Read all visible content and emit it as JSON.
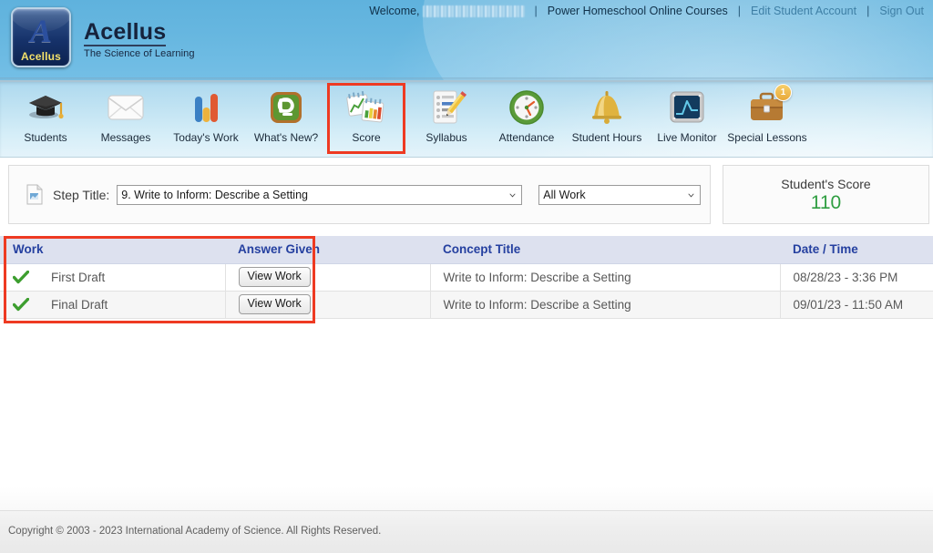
{
  "header": {
    "logo": {
      "badge_letter": "A",
      "badge_word": "Acellus",
      "title": "Acellus",
      "subtitle": "The Science of Learning"
    },
    "welcome_prefix": "Welcome,",
    "welcome_name_redacted": "",
    "links": [
      {
        "label": "Power Homeschool Online Courses",
        "muted": false
      },
      {
        "label": "Edit Student Account",
        "muted": true
      },
      {
        "label": "Sign Out",
        "muted": true
      }
    ],
    "separator": "|",
    "colors": {
      "header_blue": "#67b7e0",
      "link_muted": "#3e7fa5"
    }
  },
  "navbar": {
    "items": [
      {
        "label": "Students",
        "icon": "graduation-cap-icon",
        "selected": false,
        "badge": ""
      },
      {
        "label": "Messages",
        "icon": "envelope-icon",
        "selected": false,
        "badge": ""
      },
      {
        "label": "Today's Work",
        "icon": "bar-chart-icon",
        "selected": false,
        "badge": ""
      },
      {
        "label": "What's New?",
        "icon": "blogger-b-icon",
        "selected": false,
        "badge": ""
      },
      {
        "label": "Score",
        "icon": "score-charts-icon",
        "selected": true,
        "badge": ""
      },
      {
        "label": "Syllabus",
        "icon": "clipboard-pencil-icon",
        "selected": false,
        "badge": ""
      },
      {
        "label": "Attendance",
        "icon": "clock-icon",
        "selected": false,
        "badge": ""
      },
      {
        "label": "Student Hours",
        "icon": "bell-icon",
        "selected": false,
        "badge": ""
      },
      {
        "label": "Live Monitor",
        "icon": "monitor-graph-icon",
        "selected": false,
        "badge": ""
      },
      {
        "label": "Special Lessons",
        "icon": "briefcase-icon",
        "selected": false,
        "badge": "1"
      }
    ],
    "highlight_color": "#ee3a22"
  },
  "toolbar": {
    "step_icon": "document-icon",
    "step_label": "Step Title:",
    "step_select_value": "9. Write to Inform: Describe a Setting",
    "filter_select_value": "All Work",
    "caret_icon": "chevron-down-icon"
  },
  "score_card": {
    "caption": "Student's Score",
    "value": "110",
    "value_color": "#2f9e41"
  },
  "table": {
    "columns": [
      "Work",
      "Answer Given",
      "Concept Title",
      "Date / Time"
    ],
    "rows": [
      {
        "status_icon": "green-check-icon",
        "work": "First Draft",
        "answer_button": "View Work",
        "concept": "Write to Inform: Describe a Setting",
        "date": "08/28/23 - 3:36 PM"
      },
      {
        "status_icon": "green-check-icon",
        "work": "Final Draft",
        "answer_button": "View Work",
        "concept": "Write to Inform: Describe a Setting",
        "date": "09/01/23 - 11:50 AM"
      }
    ],
    "header_bg": "#dde1ef",
    "header_text_color": "#2540a0"
  },
  "footer": {
    "copyright": "Copyright © 2003 - 2023 International Academy of Science.  All Rights Reserved."
  }
}
